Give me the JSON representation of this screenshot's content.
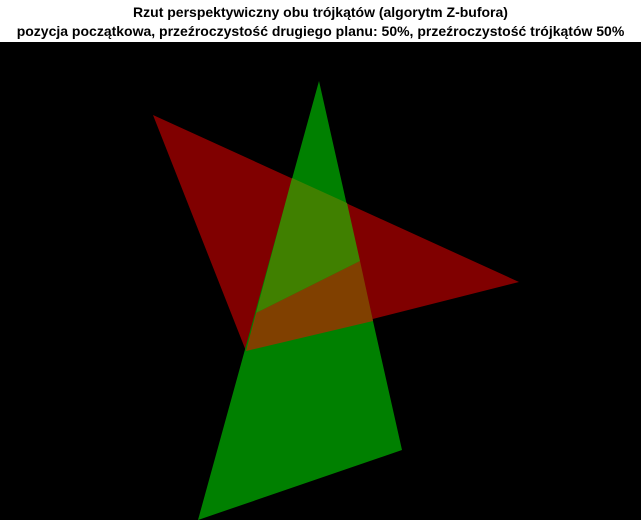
{
  "figure": {
    "title_line1": "Rzut perspektywiczny obu trójkątów (algorytm Z-bufora)",
    "title_line2": "pozycja początkowa, przeźroczystość drugiego planu: 50%, przeźroczystość trójkątów 50%"
  },
  "colors": {
    "background": "#000000",
    "red_triangle": "#800000",
    "green_triangle": "#008000",
    "overlap_green_over_red": "#408000",
    "overlap_red_over_green": "#804000"
  }
}
